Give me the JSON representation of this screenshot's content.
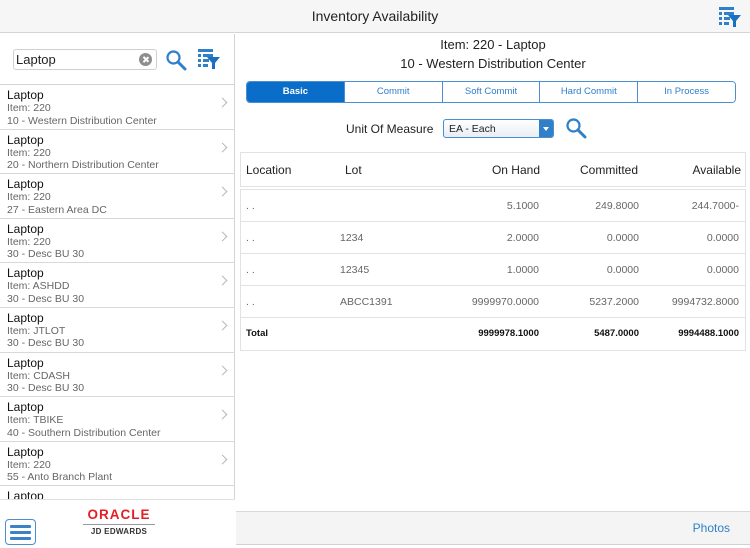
{
  "header": {
    "title": "Inventory Availability",
    "filter_icon": "list-filter-icon"
  },
  "sidebar": {
    "search": {
      "value": "Laptop",
      "placeholder": "",
      "clear_icon": "clear-circle-icon",
      "search_icon": "search-icon",
      "filter_icon": "list-filter-icon"
    },
    "items": [
      {
        "title": "Laptop",
        "item": "Item: 220",
        "branch": "10 - Western Distribution Center"
      },
      {
        "title": "Laptop",
        "item": "Item: 220",
        "branch": "20 - Northern Distribution Center"
      },
      {
        "title": "Laptop",
        "item": "Item: 220",
        "branch": "27 - Eastern Area DC"
      },
      {
        "title": "Laptop",
        "item": "Item: 220",
        "branch": "30 - Desc BU 30"
      },
      {
        "title": "Laptop",
        "item": "Item: ASHDD",
        "branch": "30 - Desc BU 30"
      },
      {
        "title": "Laptop",
        "item": "Item: JTLOT",
        "branch": "30 - Desc BU 30"
      },
      {
        "title": "Laptop",
        "item": "Item: CDASH",
        "branch": "30 - Desc BU 30"
      },
      {
        "title": "Laptop",
        "item": "Item: TBIKE",
        "branch": "40 - Southern Distribution Center"
      },
      {
        "title": "Laptop",
        "item": "Item: 220",
        "branch": "55 - Anto Branch Plant"
      },
      {
        "title": "Laptop",
        "item": "",
        "branch": ""
      }
    ],
    "footer": {
      "menu_icon": "hamburger-menu-icon",
      "logo_line1": "ORACLE",
      "logo_line2": "JD EDWARDS"
    }
  },
  "main": {
    "item_title": "Item: 220 - Laptop",
    "branch_title": "10 - Western Distribution Center",
    "tabs": [
      {
        "label": "Basic",
        "active": true
      },
      {
        "label": "Commit",
        "active": false
      },
      {
        "label": "Soft Commit",
        "active": false
      },
      {
        "label": "Hard Commit",
        "active": false
      },
      {
        "label": "In Process",
        "active": false
      }
    ],
    "uom": {
      "label": "Unit Of Measure",
      "selected": "EA - Each"
    },
    "grid": {
      "columns": [
        "Location",
        "Lot",
        "On Hand",
        "Committed",
        "Available"
      ],
      "rows": [
        {
          "location": ". .",
          "lot": "",
          "on_hand": "5.1000",
          "committed": "249.8000",
          "available": "244.7000-"
        },
        {
          "location": ". .",
          "lot": "1234",
          "on_hand": "2.0000",
          "committed": "0.0000",
          "available": "0.0000"
        },
        {
          "location": ". .",
          "lot": "12345",
          "on_hand": "1.0000",
          "committed": "0.0000",
          "available": "0.0000"
        },
        {
          "location": ". .",
          "lot": "ABCC1391",
          "on_hand": "9999970.0000",
          "committed": "5237.2000",
          "available": "9994732.8000"
        }
      ],
      "total": {
        "label": "Total",
        "on_hand": "9999978.1000",
        "committed": "5487.0000",
        "available": "9994488.1000"
      }
    },
    "footer": {
      "photos_label": "Photos"
    }
  },
  "colors": {
    "accent": "#0a6dc9",
    "link": "#2f7fc9",
    "oracle_red": "#e41e26"
  }
}
